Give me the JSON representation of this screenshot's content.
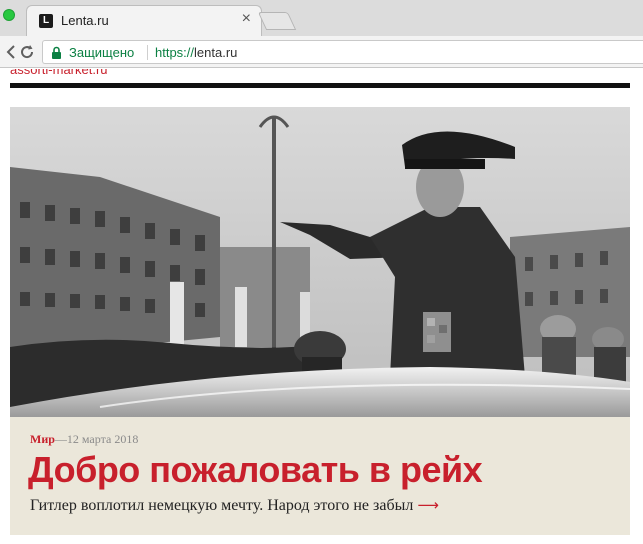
{
  "browser": {
    "tab_title": "Lenta.ru",
    "favicon_letter": "L",
    "tab_close": "×",
    "secure_label": "Защищено",
    "url_protocol": "https://",
    "url_host": "lenta.ru"
  },
  "page": {
    "ad_link": "assorti-market.ru",
    "article": {
      "rubric": "Мир",
      "date": "—12 марта 2018",
      "headline": "Добро пожаловать в рейх",
      "subheadline": "Гитлер воплотил немецкую мечту. Народ этого не забыл",
      "arrow": "⟶"
    }
  },
  "colors": {
    "accent": "#c8202c",
    "secure_green": "#0b8043",
    "caption_bg": "#ebe7da"
  },
  "icons": {
    "back": "back-arrow-icon",
    "reload": "reload-icon",
    "lock": "lock-icon",
    "close": "close-icon"
  }
}
